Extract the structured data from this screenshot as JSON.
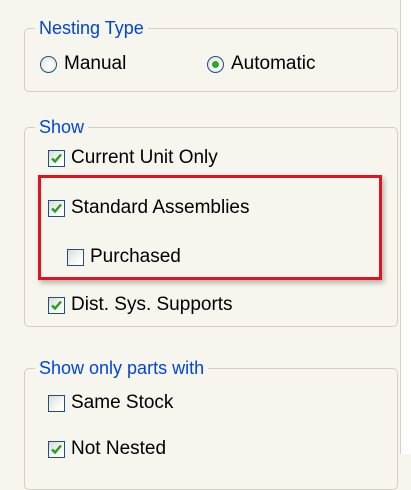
{
  "nesting_type": {
    "legend": "Nesting Type",
    "options": [
      {
        "label": "Manual",
        "selected": false
      },
      {
        "label": "Automatic",
        "selected": true
      }
    ]
  },
  "show": {
    "legend": "Show",
    "items": [
      {
        "label": "Current Unit Only",
        "checked": true
      },
      {
        "label": "Standard Assemblies",
        "checked": true
      },
      {
        "label": "Purchased",
        "checked": false
      },
      {
        "label": "Dist. Sys. Supports",
        "checked": true
      }
    ]
  },
  "show_only_parts_with": {
    "legend": "Show only parts with",
    "items": [
      {
        "label": "Same Stock",
        "checked": false
      },
      {
        "label": "Not Nested",
        "checked": true
      }
    ]
  },
  "colors": {
    "legend_blue": "#0046d5",
    "check_green": "#21a121",
    "highlight_red": "#e0141e"
  }
}
